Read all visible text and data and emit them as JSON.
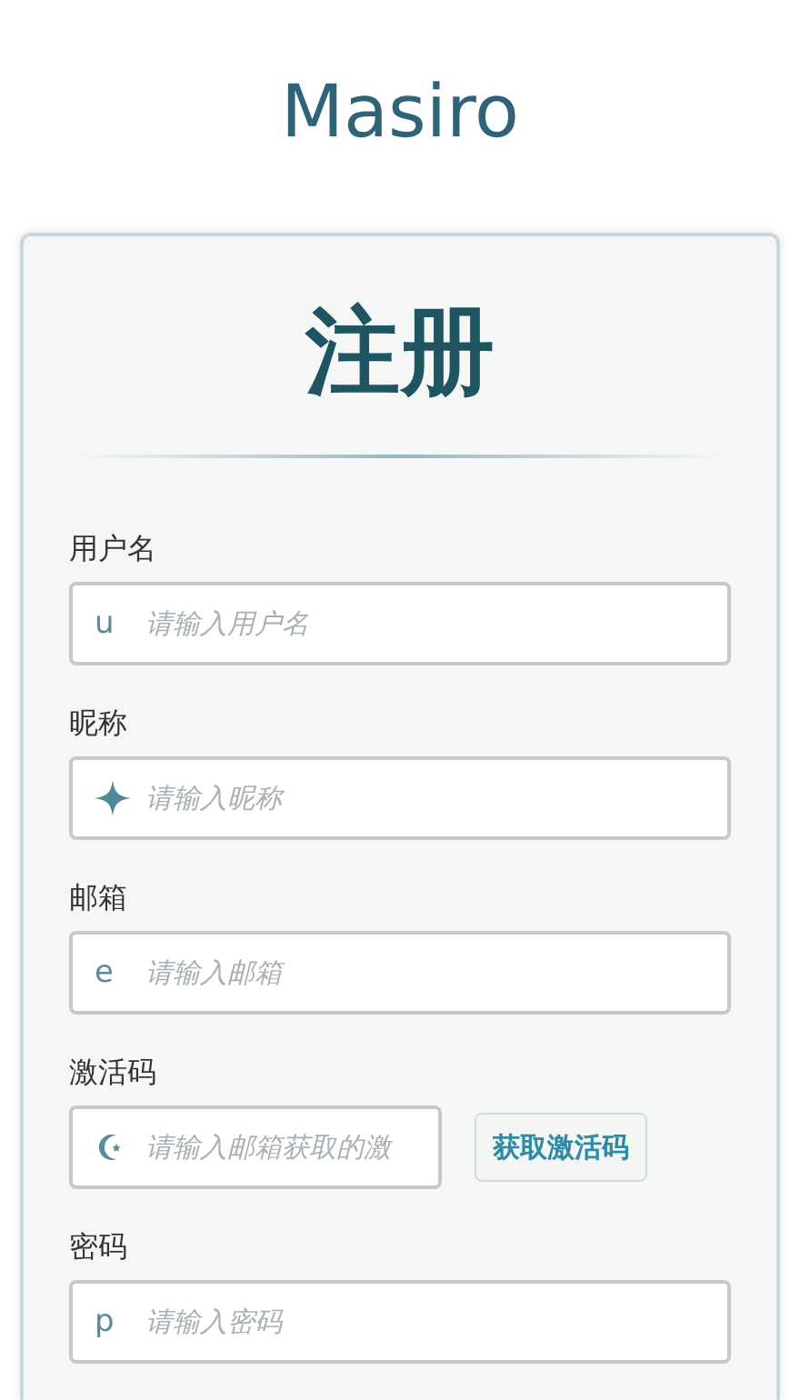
{
  "app_title": "Masiro",
  "form": {
    "heading": "注册",
    "fields": [
      {
        "label": "用户名",
        "kind": "letter",
        "prefix": "u",
        "placeholder": "请输入用户名"
      },
      {
        "label": "昵称",
        "kind": "star",
        "placeholder": "请输入昵称"
      },
      {
        "label": "邮箱",
        "kind": "letter",
        "prefix": "e",
        "placeholder": "请输入邮箱"
      },
      {
        "label": "激活码",
        "kind": "moon",
        "placeholder": "请输入邮箱获取的激",
        "button": "获取激活码"
      },
      {
        "label": "密码",
        "kind": "letter",
        "prefix": "p",
        "placeholder": "请输入密码"
      }
    ]
  }
}
